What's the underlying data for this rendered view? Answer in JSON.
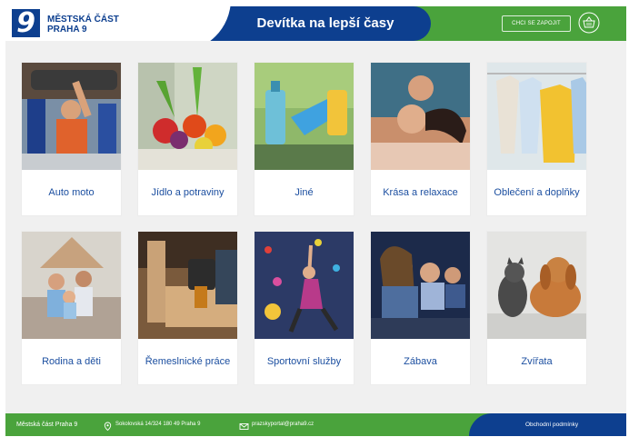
{
  "header": {
    "logo_line1": "MĚSTSKÁ ČÁST",
    "logo_line2": "PRAHA 9",
    "logo_glyph": "9",
    "title": "Devítka na lepší časy",
    "want_button": "CHCI SE ZAPOJIT",
    "basket_icon": "basket-icon",
    "colors": {
      "blue": "#0d3f8f",
      "green": "#4aa33c",
      "label": "#1c4fa0"
    }
  },
  "categories": [
    {
      "label": "Auto moto"
    },
    {
      "label": "Jídlo a potraviny"
    },
    {
      "label": "Jiné"
    },
    {
      "label": "Krása a relaxace"
    },
    {
      "label": "Oblečení a doplňky"
    },
    {
      "label": "Rodina a děti"
    },
    {
      "label": "Řemeslnické práce"
    },
    {
      "label": "Sportovní služby"
    },
    {
      "label": "Zábava"
    },
    {
      "label": "Zvířata"
    }
  ],
  "footer": {
    "name": "Městská část Praha 9",
    "address": "Sokolovská 14/324 180 49 Praha 9",
    "email": "prazskyportal@praha9.cz",
    "terms": "Obchodní podmínky",
    "address_icon": "map-pin-icon",
    "email_icon": "envelope-icon"
  }
}
